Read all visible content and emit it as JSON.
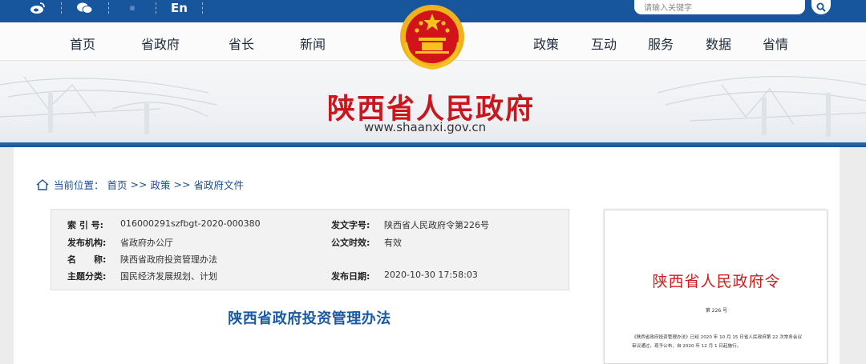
{
  "topbar": {
    "en_label": "En",
    "search_placeholder": "请输入关键字"
  },
  "nav": {
    "left": [
      "首页",
      "省政府",
      "省长",
      "新闻"
    ],
    "right": [
      "政策",
      "互动",
      "服务",
      "数据",
      "省情"
    ]
  },
  "site": {
    "title": "陕西省人民政府",
    "url": "www.shaanxi.gov.cn"
  },
  "breadcrumb": {
    "label": "当前位置：",
    "items": [
      "首页",
      ">>",
      "政策",
      ">>",
      "省政府文件"
    ]
  },
  "meta": {
    "index_label": "索 引 号:",
    "index_value": "016000291szfbgt-2020-000380",
    "issuer_label": "发布机构:",
    "issuer_value": "省政府办公厅",
    "name_label": "名　　称:",
    "name_value": "陕西省政府投资管理办法",
    "topic_label": "主题分类:",
    "topic_value": "国民经济发展规划、计划",
    "docno_label": "发文字号:",
    "docno_value": "陕西省人民政府令第226号",
    "validity_label": "公文时效:",
    "validity_value": "有效",
    "date_label": "发布日期:",
    "date_value": "2020-10-30 17:58:03"
  },
  "document": {
    "title": "陕西省政府投资管理办法"
  },
  "thumbnail": {
    "title": "陕西省人民政府令",
    "number": "第 226 号",
    "body": "《陕西省政府投资管理办法》已经 2020 年 10 月 15 日省人民政府第 22 次常务会议审议通过，现予公布，自 2020 年 12 月 1 日起施行。"
  },
  "colors": {
    "topbar": "#17569c",
    "title_red": "#c8171d",
    "link_blue": "#1a4f97"
  }
}
